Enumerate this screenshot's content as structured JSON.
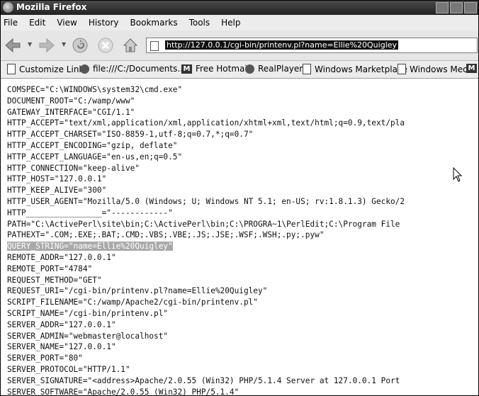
{
  "window": {
    "title": "Mozilla Firefox"
  },
  "menus": [
    "File",
    "Edit",
    "View",
    "History",
    "Bookmarks",
    "Tools",
    "Help"
  ],
  "url": "http://127.0.0.1/cgi-bin/printenv.pl?name=Ellie%20Quigley",
  "bookmarks": [
    {
      "label": "Customize Links",
      "icon": "page-icon"
    },
    {
      "label": "file:///C:/Documents...",
      "icon": "file-icon"
    },
    {
      "label": "Free Hotmail",
      "icon": "msn-icon"
    },
    {
      "label": "RealPlayer",
      "icon": "realplayer-icon"
    },
    {
      "label": "Windows Marketplace",
      "icon": "page-icon"
    },
    {
      "label": "Windows Media",
      "icon": "page-icon"
    },
    {
      "label": "",
      "icon": "msn-icon"
    }
  ],
  "env_lines": [
    "COMSPEC=\"C:\\WINDOWS\\system32\\cmd.exe\"",
    "DOCUMENT_ROOT=\"C:/wamp/www\"",
    "GATEWAY_INTERFACE=\"CGI/1.1\"",
    "HTTP_ACCEPT=\"text/xml,application/xml,application/xhtml+xml,text/html;q=0.9,text/pla",
    "HTTP_ACCEPT_CHARSET=\"ISO-8859-1,utf-8;q=0.7,*;q=0.7\"",
    "HTTP_ACCEPT_ENCODING=\"gzip, deflate\"",
    "HTTP_ACCEPT_LANGUAGE=\"en-us,en;q=0.5\"",
    "HTTP_CONNECTION=\"keep-alive\"",
    "HTTP_HOST=\"127.0.0.1\"",
    "HTTP_KEEP_ALIVE=\"300\"",
    "HTTP_USER_AGENT=\"Mozilla/5.0 (Windows; U; Windows NT 5.1; en-US; rv:1.8.1.3) Gecko/2",
    "HTTP________________=\"------------\"",
    "PATH=\"C:\\ActivePerl\\site\\bin;C:\\ActivePerl\\bin;C:\\PROGRA~1\\PerlEdit;C:\\Program File",
    "PATHEXT=\".COM;.EXE;.BAT;.CMD;.VBS;.VBE;.JS;.JSE;.WSF;.WSH;.py;.pyw\"",
    "QUERY_STRING=\"name=Ellie%20Quigley\"",
    "REMOTE_ADDR=\"127.0.0.1\"",
    "REMOTE_PORT=\"4784\"",
    "REQUEST_METHOD=\"GET\"",
    "REQUEST_URI=\"/cgi-bin/printenv.pl?name=Ellie%20Quigley\"",
    "SCRIPT_FILENAME=\"C:/wamp/Apache2/cgi-bin/printenv.pl\"",
    "SCRIPT_NAME=\"/cgi-bin/printenv.pl\"",
    "SERVER_ADDR=\"127.0.0.1\"",
    "SERVER_ADMIN=\"webmaster@localhost\"",
    "SERVER_NAME=\"127.0.0.1\"",
    "SERVER_PORT=\"80\"",
    "SERVER_PROTOCOL=\"HTTP/1.1\"",
    "SERVER_SIGNATURE=\"<address>Apache/2.0.55 (Win32) PHP/5.1.4 Server at 127.0.0.1 Port",
    "SERVER_SOFTWARE=\"Apache/2.0.55 (Win32) PHP/5.1.4\""
  ],
  "highlighted_line": "QUERY_STRING=\"name=Ellie%20Quigley\"",
  "colors": {
    "titlebar": "#222222",
    "highlight": "#a9a9a9"
  }
}
